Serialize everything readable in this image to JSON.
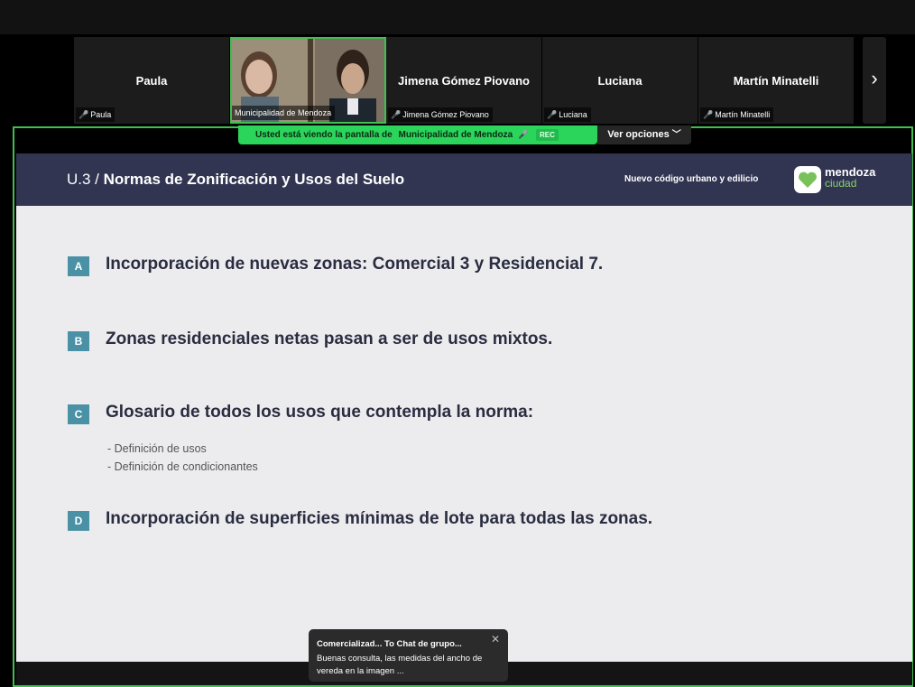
{
  "participants": [
    {
      "name": "Paula",
      "label": "Paula",
      "muted": true
    },
    {
      "name": "",
      "label": "Municipalidad de Mendoza",
      "muted": false,
      "video": true
    },
    {
      "name": "Jimena Gómez Piovano",
      "label": "Jimena Gómez Piovano",
      "muted": true
    },
    {
      "name": "Luciana",
      "label": "Luciana",
      "muted": true
    },
    {
      "name": "Martín Minatelli",
      "label": "Martín Minatelli",
      "muted": true
    }
  ],
  "share_banner": {
    "text": "Usted está viendo la pantalla de",
    "presenter": "Municipalidad de Mendoza",
    "rec": "REC",
    "view_options": "Ver opciones"
  },
  "slide": {
    "code": "U.3 /",
    "title": "Normas de Zonificación y Usos del Suelo",
    "subtitle": "Nuevo código urbano y edilicio",
    "logo_line1": "mendoza",
    "logo_line2": "ciudad",
    "items": [
      {
        "letter": "A",
        "text": "Incorporación de nuevas zonas: Comercial 3 y Residencial 7."
      },
      {
        "letter": "B",
        "text": "Zonas residenciales netas pasan a ser de usos mixtos."
      },
      {
        "letter": "C",
        "text": "Glosario de todos los usos que contempla la norma:"
      },
      {
        "letter": "D",
        "text": "Incorporación de superficies mínimas de lote para todas las zonas."
      }
    ],
    "subitems": [
      "- Definición de usos",
      "- Definición de condicionantes"
    ]
  },
  "chat_toast": {
    "title": "Comercializad... To Chat de grupo...",
    "message": "Buenas consulta, las medidas del ancho de vereda en la imagen ..."
  },
  "colors": {
    "accent_green": "#3fbf4f",
    "slide_header": "#313552",
    "badge": "#4a91a6"
  }
}
